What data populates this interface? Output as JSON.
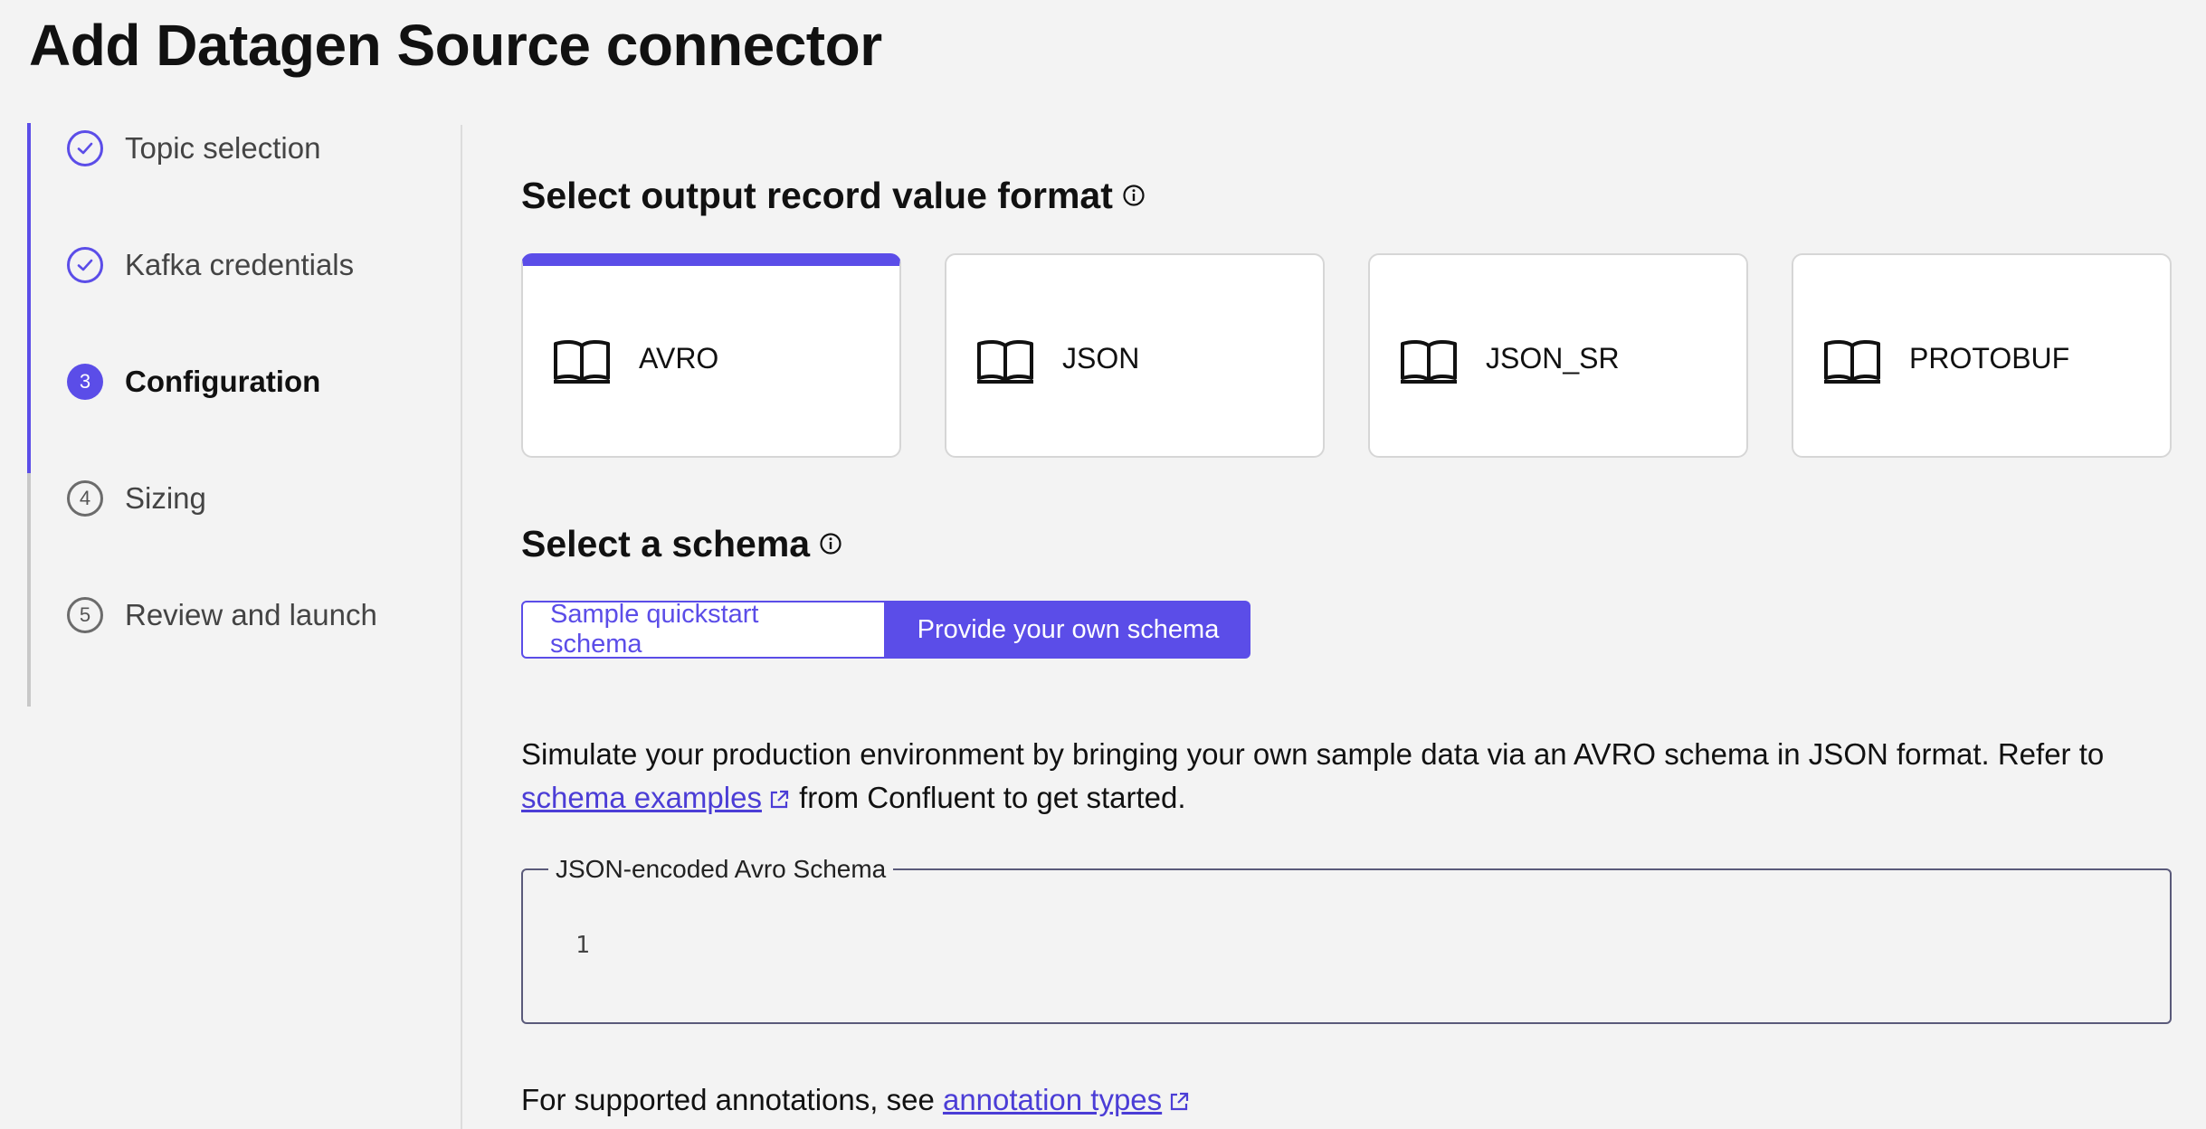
{
  "page": {
    "title": "Add Datagen Source connector"
  },
  "stepper": {
    "steps": [
      {
        "number": "1",
        "label": "Topic selection",
        "status": "done"
      },
      {
        "number": "2",
        "label": "Kafka credentials",
        "status": "done"
      },
      {
        "number": "3",
        "label": "Configuration",
        "status": "current"
      },
      {
        "number": "4",
        "label": "Sizing",
        "status": "todo"
      },
      {
        "number": "5",
        "label": "Review and launch",
        "status": "todo"
      }
    ]
  },
  "output_format": {
    "title": "Select output record value format",
    "options": [
      {
        "label": "AVRO",
        "icon": "book-icon",
        "selected": true
      },
      {
        "label": "JSON",
        "icon": "book-icon",
        "selected": false
      },
      {
        "label": "JSON_SR",
        "icon": "book-icon",
        "selected": false
      },
      {
        "label": "PROTOBUF",
        "icon": "book-icon",
        "selected": false
      }
    ]
  },
  "schema": {
    "title": "Select a schema",
    "toggle": {
      "sample_label": "Sample quickstart schema",
      "own_label": "Provide your own schema",
      "selected": "own"
    },
    "description_prefix": "Simulate your production environment by bringing your own sample data via an AVRO schema in JSON format. Refer to",
    "description_link": "schema examples",
    "description_suffix": "from Confluent to get started.",
    "editor_label": "JSON-encoded Avro Schema",
    "editor_line_number": "1",
    "annotations_prefix": "For supported annotations, see",
    "annotations_link": "annotation types"
  },
  "colors": {
    "accent": "#5b4de8",
    "link": "#4b3dd6",
    "background": "#f3f3f3"
  }
}
